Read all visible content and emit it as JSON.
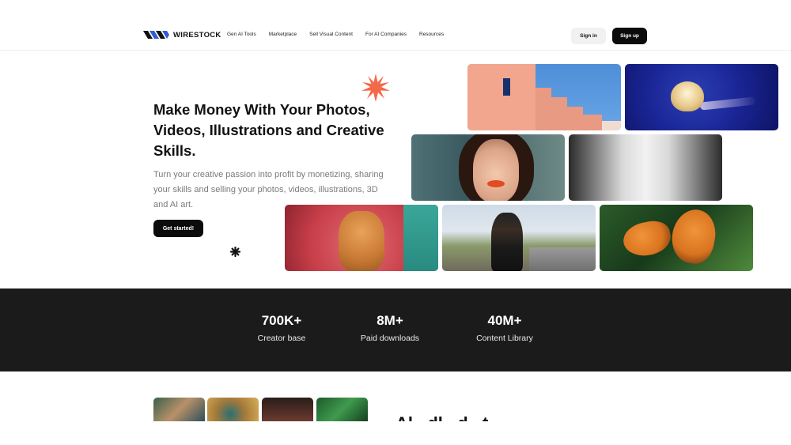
{
  "brand": {
    "name": "WIRESTOCK",
    "logo_icon": "wirestock-logo-icon"
  },
  "nav": {
    "items": [
      "Gen AI Tools",
      "Marketplace",
      "Sell Visual Content",
      "For AI Companies",
      "Resources"
    ],
    "signin_label": "Sign in",
    "signup_label": "Sign up"
  },
  "hero": {
    "title": "Make Money With Your Photos, Videos, Illustrations and Creative Skills.",
    "subtitle": "Turn your creative passion into profit by monetizing, sharing your skills and selling your photos, videos, illustrations, 3D and AI art.",
    "cta_label": "Get started!",
    "accent_color": "#f26a4a"
  },
  "stats": [
    {
      "value": "700K+",
      "label": "Creator base"
    },
    {
      "value": "8M+",
      "label": "Paid downloads"
    },
    {
      "value": "40M+",
      "label": "Content Library"
    }
  ],
  "next_section": {
    "heading_partial": "Al...dl...d...t..."
  },
  "colors": {
    "stats_bg": "#1b1b1b",
    "primary_button": "#0b0b0b",
    "secondary_button": "#f1f1f1"
  }
}
